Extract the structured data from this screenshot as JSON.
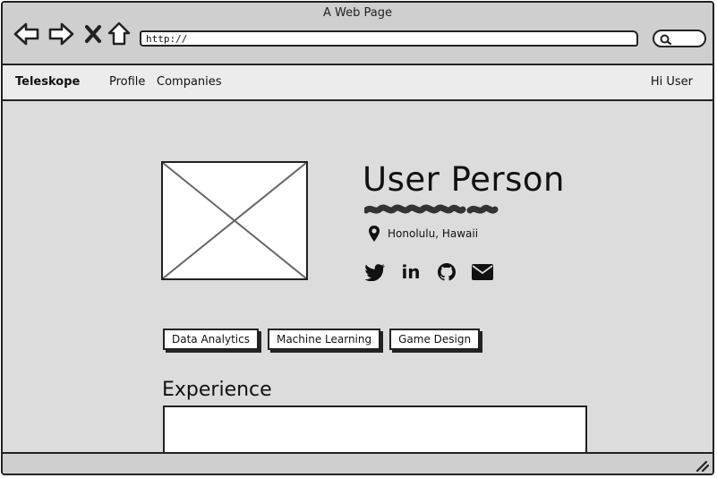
{
  "window": {
    "title": "A Web Page"
  },
  "toolbar": {
    "back_icon": "arrow-left-icon",
    "forward_icon": "arrow-right-icon",
    "stop_icon": "close-icon",
    "home_icon": "home-icon",
    "url": "http://",
    "search_icon": "search-icon"
  },
  "navbar": {
    "brand": "Teleskope",
    "links": [
      "Profile",
      "Companies"
    ],
    "greeting": "Hi User"
  },
  "profile": {
    "name": "User Person",
    "location": "Honolulu, Hawaii",
    "location_icon": "map-pin-icon",
    "socials": [
      "twitter-icon",
      "linkedin-icon",
      "github-icon",
      "envelope-icon"
    ]
  },
  "skills": [
    "Data Analytics",
    "Machine Learning",
    "Game Design"
  ],
  "experience": {
    "heading": "Experience"
  },
  "colors": {
    "stroke": "#222222",
    "page_bg": "#dcdcdc",
    "chrome_bg": "#cfcfcf",
    "navbar_bg": "#ececec",
    "panel_bg": "#ffffff"
  }
}
